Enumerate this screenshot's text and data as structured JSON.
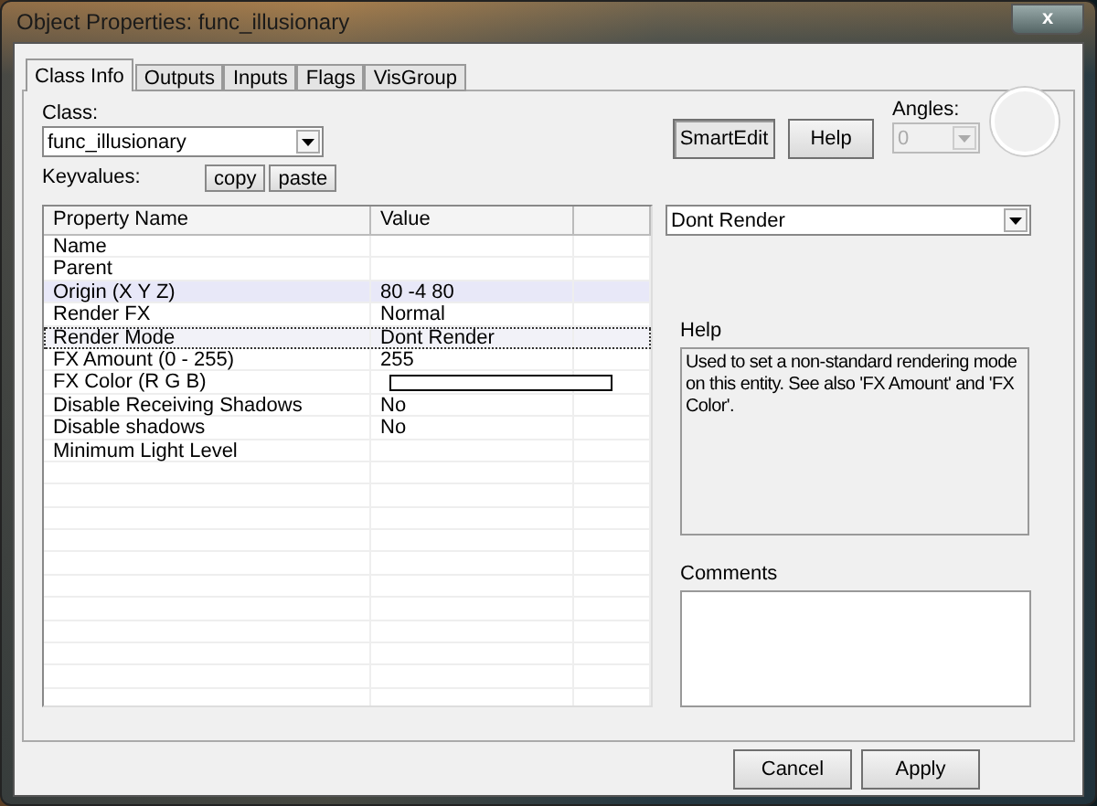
{
  "window": {
    "title": "Object Properties: func_illusionary",
    "close": "x"
  },
  "tabs": [
    {
      "label": "Class Info",
      "selected": true
    },
    {
      "label": "Outputs",
      "selected": false
    },
    {
      "label": "Inputs",
      "selected": false
    },
    {
      "label": "Flags",
      "selected": false
    },
    {
      "label": "VisGroup",
      "selected": false
    }
  ],
  "class_field": {
    "label": "Class:",
    "value": "func_illusionary"
  },
  "keyvalues": {
    "label": "Keyvalues:",
    "buttons": [
      "copy",
      "paste"
    ]
  },
  "smartedit": {
    "label": "SmartEdit",
    "pressed": true
  },
  "help_button": "Help",
  "angles": {
    "label": "Angles:",
    "value": "0",
    "disabled": true
  },
  "table": {
    "columns": [
      "Property Name",
      "Value"
    ],
    "rows": [
      {
        "name": "Name",
        "kind": "text",
        "value": "",
        "hovered": false,
        "selected": false
      },
      {
        "name": "Parent",
        "kind": "text",
        "value": "",
        "hovered": false,
        "selected": false
      },
      {
        "name": "Origin (X Y Z)",
        "kind": "text",
        "value": "80 -4 80",
        "hovered": true,
        "selected": false
      },
      {
        "name": "Render FX",
        "kind": "text",
        "value": "Normal",
        "hovered": false,
        "selected": false
      },
      {
        "name": "Render Mode",
        "kind": "text",
        "value": "Dont Render",
        "hovered": false,
        "selected": true
      },
      {
        "name": "FX Amount (0 - 255)",
        "kind": "text",
        "value": "255",
        "hovered": false,
        "selected": false
      },
      {
        "name": "FX Color (R G B)",
        "kind": "swatch",
        "color": "#ffffff",
        "hovered": false,
        "selected": false
      },
      {
        "name": "Disable Receiving Shadows",
        "kind": "text",
        "value": "No",
        "hovered": false,
        "selected": false
      },
      {
        "name": "Disable shadows",
        "kind": "text",
        "value": "No",
        "hovered": false,
        "selected": false
      },
      {
        "name": "Minimum Light Level",
        "kind": "text",
        "value": "",
        "hovered": false,
        "selected": false
      }
    ]
  },
  "value_dropdown": {
    "value": "Dont Render"
  },
  "help": {
    "label": "Help",
    "text": "Used to set a non-standard rendering mode on this entity. See also 'FX Amount' and 'FX Color'."
  },
  "comments": {
    "label": "Comments"
  },
  "buttons": [
    "Cancel",
    "Apply"
  ]
}
